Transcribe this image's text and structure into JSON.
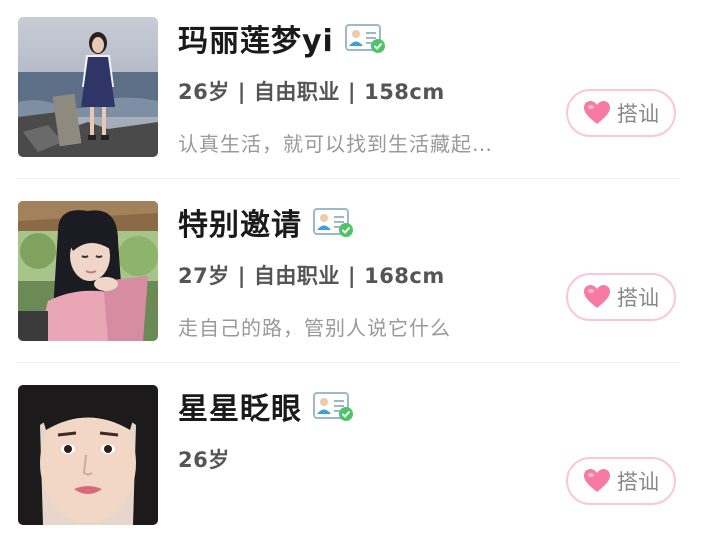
{
  "profiles": [
    {
      "name": "玛丽莲梦yi",
      "age": "26岁",
      "job": "自由职业",
      "height": "158cm",
      "separator": "|",
      "bio": "认真生活，就可以找到生活藏起…",
      "button_label": "搭讪",
      "avatar_icon": "avatar-photo",
      "verify_icon": "id-verified-icon"
    },
    {
      "name": "特别邀请",
      "age": "27岁",
      "job": "自由职业",
      "height": "168cm",
      "separator": "|",
      "bio": "走自己的路，管别人说它什么",
      "button_label": "搭讪",
      "avatar_icon": "avatar-photo",
      "verify_icon": "id-verified-icon"
    },
    {
      "name": "星星眨眼",
      "age": "26岁",
      "button_label": "搭讪",
      "avatar_icon": "avatar-photo",
      "verify_icon": "id-verified-icon"
    }
  ],
  "colors": {
    "heart": "#f57aa4",
    "button_border": "#f9c7d8",
    "verify_green": "#4cc467",
    "verify_blue": "#3aa0e0"
  }
}
